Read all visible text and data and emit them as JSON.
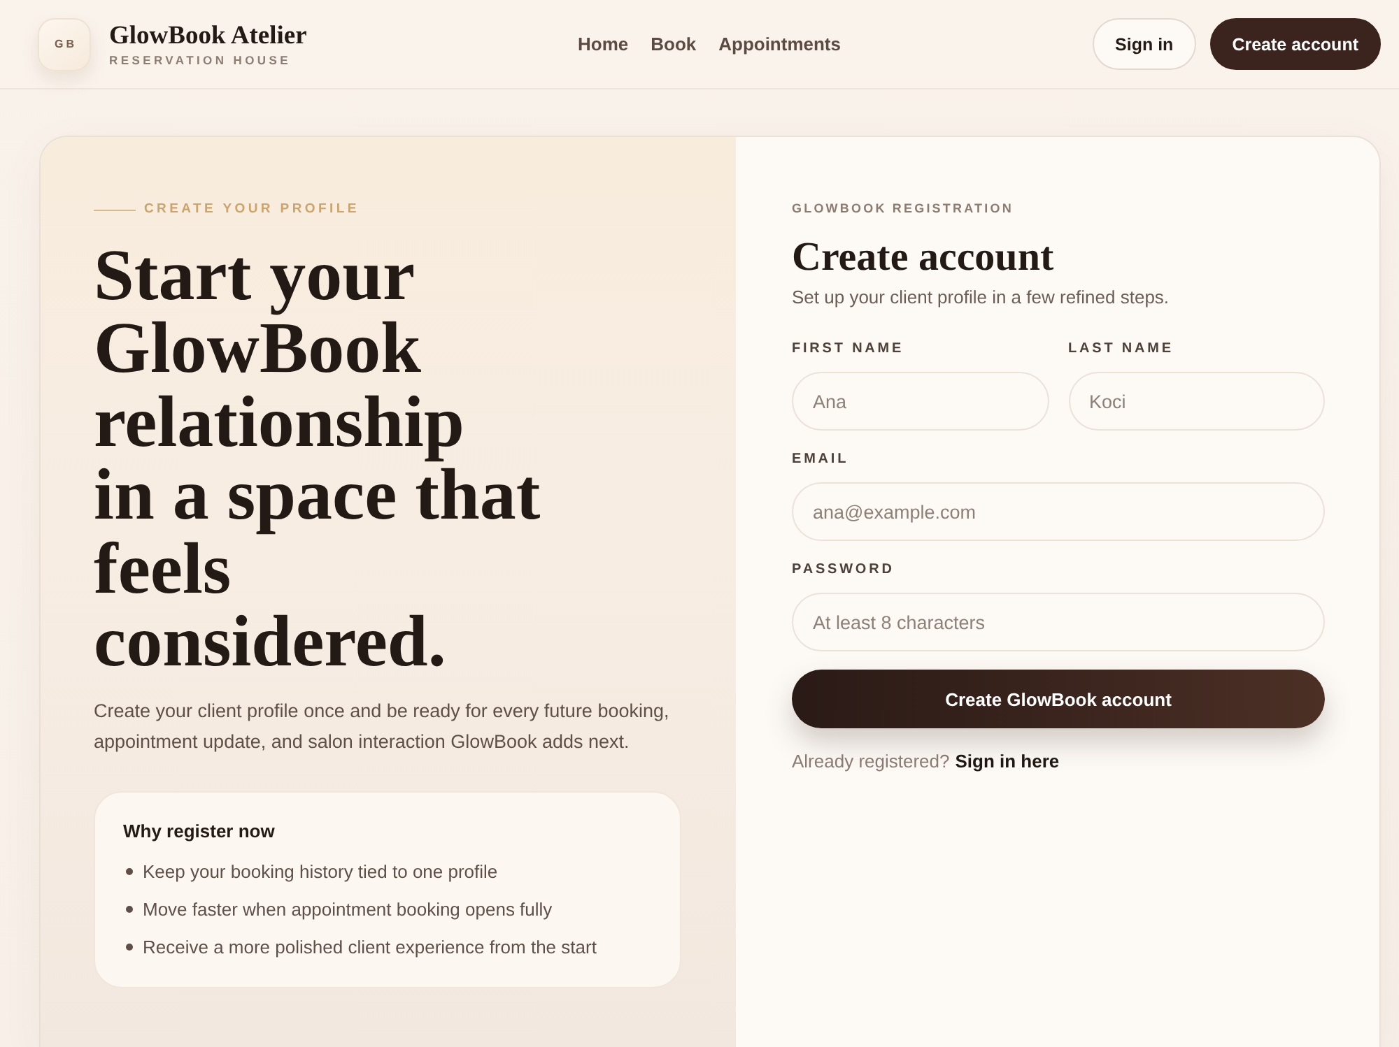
{
  "header": {
    "logo_mark": "GB",
    "brand_name": "GlowBook Atelier",
    "brand_tagline": "RESERVATION HOUSE",
    "nav": [
      {
        "label": "Home"
      },
      {
        "label": "Book"
      },
      {
        "label": "Appointments"
      }
    ],
    "actions": [
      {
        "label": "Sign in",
        "kind": "secondary"
      },
      {
        "label": "Create account",
        "kind": "primary"
      }
    ]
  },
  "intro": {
    "eyebrow": "CREATE YOUR PROFILE",
    "headline": [
      "Start your GlowBook relationship",
      "in a space that feels considered."
    ],
    "description": "Create your client profile once and be ready for every future booking, appointment update, and salon interaction GlowBook adds next.",
    "benefits": {
      "title": "Why register now",
      "items": [
        "Keep your booking history tied to one profile",
        "Move faster when appointment booking opens fully",
        "Receive a more polished client experience from the start"
      ]
    }
  },
  "form": {
    "eyebrow": "GLOWBOOK REGISTRATION",
    "title": "Create account",
    "subtitle": "Set up your client profile in a few refined steps.",
    "field_rows": [
      [
        {
          "label": "FIRST NAME",
          "placeholder": "Ana"
        },
        {
          "label": "LAST NAME",
          "placeholder": "Koci"
        }
      ],
      [
        {
          "label": "EMAIL",
          "placeholder": "ana@example.com"
        }
      ],
      [
        {
          "label": "PASSWORD",
          "placeholder": "At least 8 characters"
        }
      ]
    ],
    "submit": "Create GlowBook account",
    "footer": {
      "text": "Already registered?",
      "link": "Sign in here"
    }
  }
}
